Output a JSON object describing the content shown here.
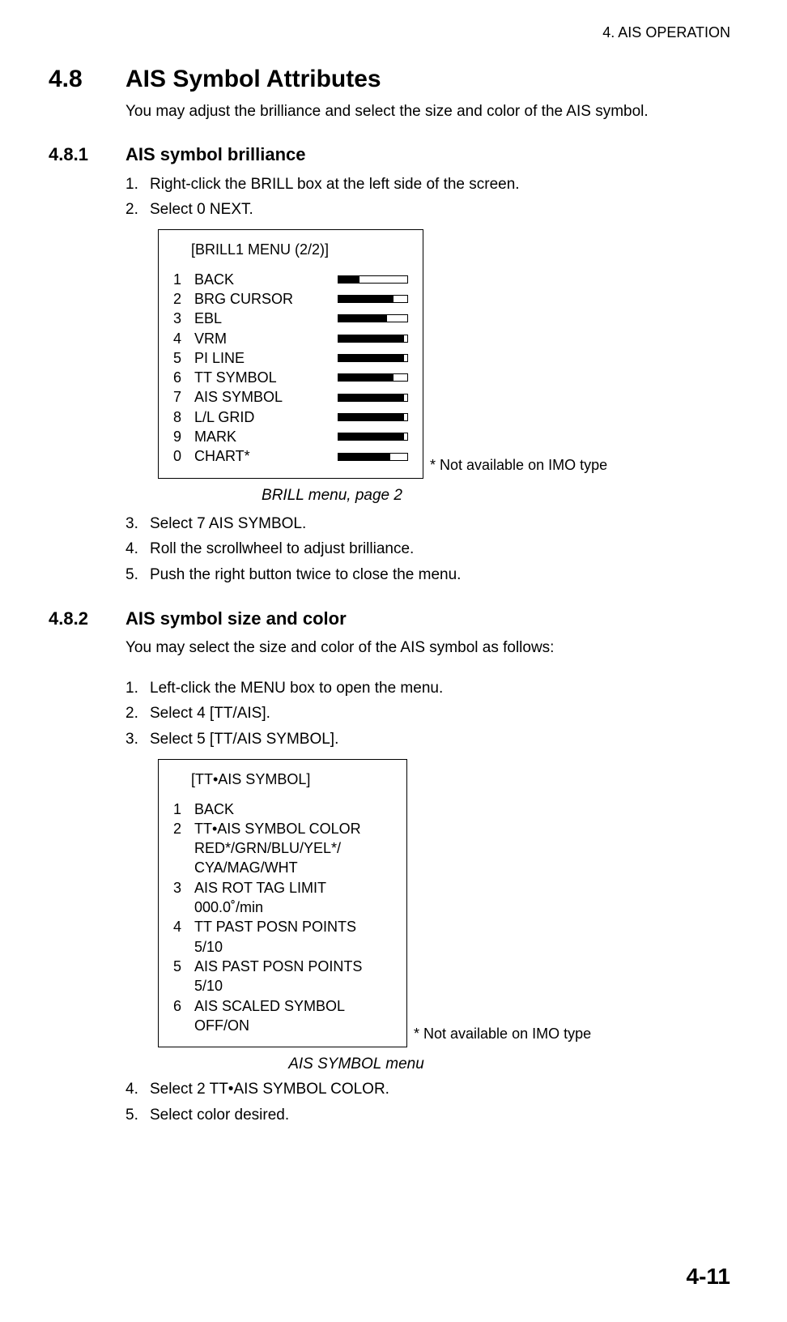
{
  "running_head": "4. AIS OPERATION",
  "sec_4_8": {
    "num": "4.8",
    "title": "AIS Symbol Attributes",
    "intro": "You may adjust the brilliance and select the size and color of the AIS symbol."
  },
  "sec_4_8_1": {
    "num": "4.8.1",
    "title": "AIS symbol brilliance",
    "steps_a": [
      "Right-click the BRILL box at the left side of the screen.",
      "Select 0 NEXT."
    ],
    "menu_title": "[BRILL1 MENU (2/2)]",
    "menu_items": [
      {
        "idx": "1",
        "label": "BACK",
        "fill": 30
      },
      {
        "idx": "2",
        "label": "BRG CURSOR",
        "fill": 80
      },
      {
        "idx": "3",
        "label": "EBL",
        "fill": 70
      },
      {
        "idx": "4",
        "label": "VRM",
        "fill": 95
      },
      {
        "idx": "5",
        "label": "PI LINE",
        "fill": 95
      },
      {
        "idx": "6",
        "label": "TT SYMBOL",
        "fill": 80
      },
      {
        "idx": "7",
        "label": "AIS SYMBOL",
        "fill": 95
      },
      {
        "idx": "8",
        "label": "L/L GRID",
        "fill": 95
      },
      {
        "idx": "9",
        "label": "MARK",
        "fill": 95
      },
      {
        "idx": "0",
        "label": "CHART*",
        "fill": 75
      }
    ],
    "side_note": "* Not available on IMO type",
    "caption": "BRILL menu, page 2",
    "steps_b": [
      "Select 7 AIS SYMBOL.",
      "Roll the scrollwheel to adjust brilliance.",
      "Push the right button twice to close the menu."
    ]
  },
  "sec_4_8_2": {
    "num": "4.8.2",
    "title": "AIS symbol size and color",
    "intro": "You may select the size and color of the AIS symbol as follows:",
    "steps_a": [
      "Left-click the MENU box to open the menu.",
      "Select 4 [TT/AIS].",
      "Select 5 [TT/AIS SYMBOL]."
    ],
    "menu_title": "[TT•AIS SYMBOL]",
    "menu_items": [
      {
        "idx": "1",
        "label": "BACK"
      },
      {
        "idx": "2",
        "label": "TT•AIS SYMBOL COLOR",
        "sub": "RED*/GRN/BLU/YEL*/\nCYA/MAG/WHT"
      },
      {
        "idx": "3",
        "label": "AIS ROT TAG LIMIT",
        "sub": "000.0˚/min"
      },
      {
        "idx": "4",
        "label": "TT PAST POSN POINTS",
        "sub": "5/10"
      },
      {
        "idx": "5",
        "label": "AIS PAST POSN POINTS",
        "sub": "5/10"
      },
      {
        "idx": "6",
        "label": "AIS SCALED SYMBOL",
        "sub": "OFF/ON"
      }
    ],
    "side_note": "* Not available on IMO type",
    "caption": "AIS SYMBOL menu",
    "steps_b": [
      "Select 2 TT•AIS SYMBOL COLOR.",
      "Select color desired."
    ]
  },
  "page_number": "4-11"
}
